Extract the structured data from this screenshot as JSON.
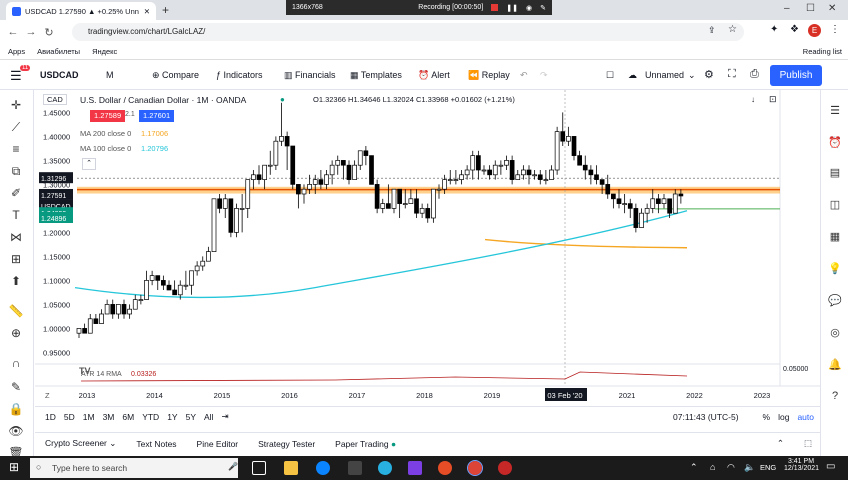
{
  "browser": {
    "tab_title": "USDCAD 1.27590 ▲ +0.25% Unn",
    "new_tab": "+",
    "recording": {
      "resolution": "1366x768",
      "status": "Recording [00:00:50]"
    },
    "url": "tradingview.com/chart/LGalcLAZ/",
    "bookmarks": [
      "Apps",
      "Авиабилеты",
      "Яндекс"
    ],
    "reading_list": "Reading list",
    "profile_letter": "E"
  },
  "toolbar": {
    "symbol": "USDCAD",
    "interval": "M",
    "compare": "Compare",
    "indicators": "Indicators",
    "financials": "Financials",
    "templates": "Templates",
    "alert": "Alert",
    "replay": "Replay",
    "layout_name": "Unnamed",
    "publish": "Publish",
    "notif_count": "11"
  },
  "legend": {
    "currency": "CAD",
    "title": "U.S. Dollar / Canadian Dollar · 1M · OANDA",
    "ohlc": "O1.32366  H1.34646  L1.32024  C1.33968  +0.01602 (+1.21%)",
    "bid": "1.27589",
    "spread": "2.1",
    "ask": "1.27601",
    "ma200_label": "MA 200 close 0",
    "ma200_value": "1.17006",
    "ma100_label": "MA 100 close 0",
    "ma100_value": "1.20796",
    "atr_label": "ATR 14 RMA",
    "atr_value": "0.03326"
  },
  "price_axis": {
    "ticks": [
      "1.45000",
      "1.40000",
      "1.35000",
      "1.30000",
      "1.20000",
      "1.15000",
      "1.10000",
      "1.05000",
      "1.00000",
      "0.95000"
    ],
    "labels": [
      {
        "text": "1.31296",
        "color": "#131722"
      },
      {
        "text": "1.27591",
        "color": "#131722"
      },
      {
        "text": "USDCAD",
        "color": "#131722"
      },
      {
        "text": "1.24899",
        "color": "#089981"
      },
      {
        "text": "1.24896",
        "color": "#089981"
      }
    ],
    "atr_axis": "0.05000"
  },
  "time_axis": {
    "ticks": [
      "2013",
      "2014",
      "2015",
      "2016",
      "2017",
      "2018",
      "2019",
      "03 Feb '20",
      "2021",
      "2022",
      "2023"
    ]
  },
  "range_bar": {
    "ranges": [
      "1D",
      "5D",
      "1M",
      "3M",
      "6M",
      "YTD",
      "1Y",
      "5Y",
      "All"
    ],
    "time": "07:11:43 (UTC-5)",
    "percent": "%",
    "log": "log",
    "auto": "auto"
  },
  "panels": [
    "Crypto Screener",
    "Text Notes",
    "Pine Editor",
    "Strategy Tester",
    "Paper Trading"
  ],
  "taskbar": {
    "search_placeholder": "Type here to search",
    "language": "ENG",
    "time": "3:41 PM",
    "date": "12/13/2021"
  },
  "colors": {
    "accent": "#2962ff",
    "up": "#ffffff",
    "down": "#000000",
    "ma100": "#26c6da",
    "ma200": "#f5a623",
    "green_line": "#4caf50",
    "orange_band": "#ff9800",
    "atr": "#b71c1c",
    "bid": "#f23645",
    "ask": "#2962ff"
  },
  "chart_data": {
    "type": "candlestick",
    "symbol": "USDCAD",
    "interval": "1M",
    "years": [
      2013,
      2014,
      2015,
      2016,
      2017,
      2018,
      2019,
      2020,
      2021,
      2022,
      2023
    ],
    "ylim": [
      0.93,
      1.48
    ],
    "candles": [
      [
        0.99,
        1.0,
        0.98,
        1.0
      ],
      [
        1.0,
        1.01,
        0.99,
        0.99
      ],
      [
        0.99,
        1.03,
        0.99,
        1.02
      ],
      [
        1.02,
        1.03,
        1.01,
        1.01
      ],
      [
        1.01,
        1.04,
        1.01,
        1.03
      ],
      [
        1.03,
        1.06,
        1.03,
        1.05
      ],
      [
        1.05,
        1.06,
        1.02,
        1.03
      ],
      [
        1.03,
        1.05,
        1.02,
        1.05
      ],
      [
        1.05,
        1.06,
        1.02,
        1.03
      ],
      [
        1.03,
        1.05,
        1.02,
        1.04
      ],
      [
        1.04,
        1.07,
        1.04,
        1.06
      ],
      [
        1.06,
        1.07,
        1.05,
        1.06
      ],
      [
        1.06,
        1.12,
        1.06,
        1.1
      ],
      [
        1.1,
        1.12,
        1.09,
        1.11
      ],
      [
        1.11,
        1.11,
        1.08,
        1.1
      ],
      [
        1.1,
        1.11,
        1.08,
        1.09
      ],
      [
        1.09,
        1.1,
        1.08,
        1.08
      ],
      [
        1.08,
        1.1,
        1.07,
        1.07
      ],
      [
        1.07,
        1.1,
        1.06,
        1.09
      ],
      [
        1.09,
        1.12,
        1.08,
        1.09
      ],
      [
        1.09,
        1.12,
        1.07,
        1.12
      ],
      [
        1.12,
        1.14,
        1.11,
        1.13
      ],
      [
        1.13,
        1.15,
        1.12,
        1.14
      ],
      [
        1.14,
        1.17,
        1.14,
        1.16
      ],
      [
        1.16,
        1.27,
        1.16,
        1.27
      ],
      [
        1.27,
        1.28,
        1.24,
        1.25
      ],
      [
        1.25,
        1.28,
        1.23,
        1.27
      ],
      [
        1.27,
        1.27,
        1.19,
        1.2
      ],
      [
        1.2,
        1.26,
        1.19,
        1.25
      ],
      [
        1.25,
        1.28,
        1.2,
        1.25
      ],
      [
        1.25,
        1.3,
        1.23,
        1.31
      ],
      [
        1.31,
        1.33,
        1.29,
        1.32
      ],
      [
        1.32,
        1.34,
        1.3,
        1.31
      ],
      [
        1.31,
        1.34,
        1.29,
        1.34
      ],
      [
        1.34,
        1.37,
        1.32,
        1.34
      ],
      [
        1.34,
        1.4,
        1.33,
        1.39
      ],
      [
        1.39,
        1.47,
        1.38,
        1.4
      ],
      [
        1.4,
        1.41,
        1.33,
        1.38
      ],
      [
        1.38,
        1.38,
        1.29,
        1.3
      ],
      [
        1.3,
        1.3,
        1.25,
        1.28
      ],
      [
        1.28,
        1.3,
        1.26,
        1.29
      ],
      [
        1.29,
        1.32,
        1.28,
        1.3
      ],
      [
        1.3,
        1.32,
        1.28,
        1.31
      ],
      [
        1.31,
        1.33,
        1.29,
        1.3
      ],
      [
        1.3,
        1.33,
        1.29,
        1.32
      ],
      [
        1.32,
        1.35,
        1.3,
        1.34
      ],
      [
        1.34,
        1.36,
        1.32,
        1.35
      ],
      [
        1.35,
        1.35,
        1.31,
        1.34
      ],
      [
        1.34,
        1.35,
        1.3,
        1.31
      ],
      [
        1.31,
        1.35,
        1.31,
        1.34
      ],
      [
        1.34,
        1.37,
        1.33,
        1.37
      ],
      [
        1.37,
        1.38,
        1.34,
        1.36
      ],
      [
        1.36,
        1.36,
        1.3,
        1.3
      ],
      [
        1.3,
        1.31,
        1.24,
        1.25
      ],
      [
        1.25,
        1.27,
        1.24,
        1.26
      ],
      [
        1.26,
        1.3,
        1.25,
        1.25
      ],
      [
        1.25,
        1.29,
        1.24,
        1.29
      ],
      [
        1.29,
        1.29,
        1.23,
        1.26
      ],
      [
        1.26,
        1.29,
        1.25,
        1.26
      ],
      [
        1.26,
        1.29,
        1.26,
        1.27
      ],
      [
        1.27,
        1.29,
        1.23,
        1.24
      ],
      [
        1.24,
        1.26,
        1.23,
        1.25
      ],
      [
        1.25,
        1.26,
        1.22,
        1.23
      ],
      [
        1.23,
        1.29,
        1.22,
        1.29
      ],
      [
        1.29,
        1.3,
        1.27,
        1.29
      ],
      [
        1.29,
        1.32,
        1.28,
        1.31
      ],
      [
        1.31,
        1.33,
        1.3,
        1.31
      ],
      [
        1.31,
        1.33,
        1.3,
        1.31
      ],
      [
        1.31,
        1.33,
        1.3,
        1.32
      ],
      [
        1.32,
        1.34,
        1.31,
        1.33
      ],
      [
        1.33,
        1.37,
        1.31,
        1.36
      ],
      [
        1.36,
        1.37,
        1.31,
        1.33
      ],
      [
        1.33,
        1.34,
        1.32,
        1.33
      ],
      [
        1.33,
        1.34,
        1.31,
        1.32
      ],
      [
        1.32,
        1.35,
        1.31,
        1.34
      ],
      [
        1.34,
        1.35,
        1.32,
        1.34
      ],
      [
        1.34,
        1.36,
        1.33,
        1.35
      ],
      [
        1.35,
        1.36,
        1.3,
        1.31
      ],
      [
        1.31,
        1.33,
        1.31,
        1.32
      ],
      [
        1.32,
        1.34,
        1.31,
        1.33
      ],
      [
        1.33,
        1.34,
        1.3,
        1.32
      ],
      [
        1.32,
        1.33,
        1.31,
        1.32
      ],
      [
        1.32,
        1.33,
        1.3,
        1.31
      ],
      [
        1.31,
        1.33,
        1.3,
        1.31
      ],
      [
        1.31,
        1.34,
        1.31,
        1.33
      ],
      [
        1.33,
        1.42,
        1.32,
        1.41
      ],
      [
        1.41,
        1.45,
        1.38,
        1.39
      ],
      [
        1.39,
        1.42,
        1.38,
        1.4
      ],
      [
        1.4,
        1.4,
        1.35,
        1.36
      ],
      [
        1.36,
        1.37,
        1.34,
        1.34
      ],
      [
        1.34,
        1.36,
        1.31,
        1.33
      ],
      [
        1.33,
        1.34,
        1.3,
        1.32
      ],
      [
        1.32,
        1.34,
        1.3,
        1.31
      ],
      [
        1.31,
        1.31,
        1.28,
        1.3
      ],
      [
        1.3,
        1.32,
        1.27,
        1.28
      ],
      [
        1.28,
        1.28,
        1.25,
        1.27
      ],
      [
        1.27,
        1.29,
        1.25,
        1.26
      ],
      [
        1.26,
        1.28,
        1.24,
        1.26
      ],
      [
        1.26,
        1.27,
        1.23,
        1.25
      ],
      [
        1.25,
        1.26,
        1.2,
        1.21
      ],
      [
        1.21,
        1.25,
        1.21,
        1.24
      ],
      [
        1.24,
        1.26,
        1.22,
        1.25
      ],
      [
        1.25,
        1.29,
        1.24,
        1.27
      ],
      [
        1.27,
        1.28,
        1.24,
        1.26
      ],
      [
        1.26,
        1.28,
        1.25,
        1.27
      ],
      [
        1.27,
        1.27,
        1.23,
        1.24
      ],
      [
        1.24,
        1.29,
        1.24,
        1.28
      ],
      [
        1.28,
        1.29,
        1.26,
        1.2759
      ]
    ],
    "atr_label": "ATR 14 RMA 0.03326"
  }
}
